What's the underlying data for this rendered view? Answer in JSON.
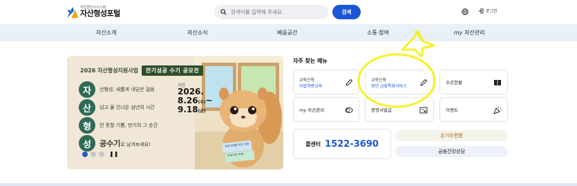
{
  "header": {
    "logo_sub": "자립형전서시스템",
    "logo_title": "자산형성포털",
    "search_placeholder": "검색어를 입력해 주세요.",
    "search_button": "검색",
    "login_label": "로그인"
  },
  "nav": {
    "items": [
      {
        "label": "자산소개"
      },
      {
        "label": "자산소식"
      },
      {
        "label": "배움공간"
      },
      {
        "label": "소통·참여"
      },
      {
        "label_my": "my",
        "label_rest": " 자산관리"
      }
    ]
  },
  "banner": {
    "title": "2026 자산형성지원사업",
    "badge": "만기성공 수기 공모전",
    "lines": [
      {
        "syl": "자",
        "text": "산형성, 새롭게 내딛은 걸음"
      },
      {
        "syl": "산",
        "text": "넘고 물 건너온 삼년의 시간"
      },
      {
        "syl": "형",
        "text": "언 못할 기쁨, 만기의 그 순간"
      },
      {
        "syl": "성",
        "text_big": "공수기",
        "text": "로 남겨보세요!"
      }
    ],
    "period_label": "기간",
    "period_line1": "2026.",
    "period_line2": "8.26",
    "period_day2": "(수)",
    "period_line3": "9.18",
    "period_day3": "(금)",
    "book1": "청년미래를 위한 희망",
    "book2": "희망자산 위해",
    "pause": "❚❚"
  },
  "frequent_menu": {
    "title": "자주 찾는 메뉴",
    "cards": [
      {
        "small": "교육신청",
        "sub": "자립역량교육",
        "icon": "pencil-icon"
      },
      {
        "small": "교육신청",
        "sub": "청년 금융특화서비스",
        "icon": "pencil-icon"
      },
      {
        "label": "수강현황",
        "icon": "book-icon"
      },
      {
        "label_my": "my",
        "label": " 자산관리",
        "icon": "coin-icon"
      },
      {
        "label": "증명서발급",
        "icon": "certificate-icon"
      },
      {
        "label": "이벤트",
        "icon": "party-icon"
      }
    ]
  },
  "call_center": {
    "label": "콜센터",
    "number": "1522-3690"
  },
  "pills": {
    "first": "온기우편함",
    "second": "금융건강상담"
  },
  "colors": {
    "accent": "#1a56d6",
    "nav_bg": "#e9f0f8",
    "highlight": "#f5ef10"
  }
}
